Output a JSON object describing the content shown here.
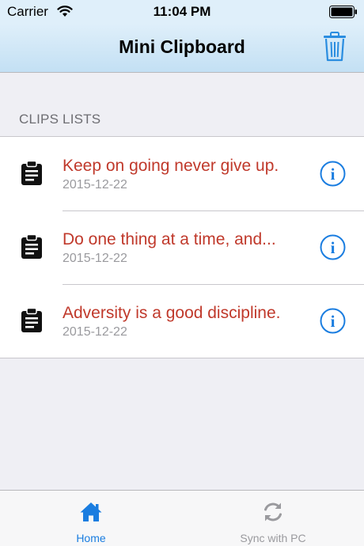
{
  "status_bar": {
    "carrier": "Carrier",
    "time": "11:04 PM"
  },
  "nav": {
    "title": "Mini Clipboard",
    "trash_icon": "trash-icon"
  },
  "section": {
    "header": "CLIPS LISTS"
  },
  "clips": [
    {
      "text": "Keep on going never give up.",
      "date": "2015-12-22"
    },
    {
      "text": "Do one thing at a time, and...",
      "date": "2015-12-22"
    },
    {
      "text": "Adversity is a good discipline.",
      "date": "2015-12-22"
    }
  ],
  "tabs": [
    {
      "label": "Home",
      "icon": "home-icon",
      "active": true
    },
    {
      "label": "Sync with PC",
      "icon": "sync-icon",
      "active": false
    }
  ],
  "colors": {
    "accent": "#1a7de0",
    "clip_text": "#c0392b",
    "nav_bg": "#c3e0f4"
  }
}
